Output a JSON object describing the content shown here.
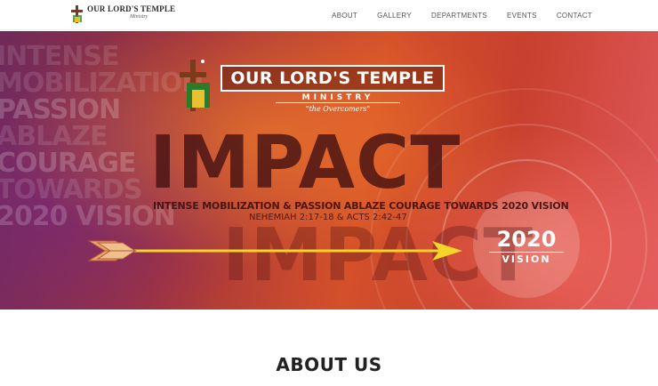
{
  "site": {
    "brand_title": "OUR LORD'S TEMPLE",
    "brand_sub": "Ministry"
  },
  "nav": {
    "items": [
      "ABOUT",
      "GALLERY",
      "DEPARTMENTS",
      "EVENTS",
      "CONTACT"
    ]
  },
  "hero": {
    "bg_words": [
      "INTENSE",
      "MOBILIZATION",
      "PASSION",
      "ABLAZE",
      "COURAGE",
      "TOWARDS",
      "2020 VISION"
    ],
    "logo_title": "OUR LORD'S TEMPLE",
    "logo_ministry": "MINISTRY",
    "logo_tagline": "\"the Overcomers\"",
    "headline": "IMPACT",
    "tagline": "INTENSE MOBILIZATION & PASSION ABLAZE COURAGE TOWARDS 2020 VISION",
    "verse": "NEHEMIAH 2:17-18 & ACTS 2:42-47",
    "vision_year": "2020",
    "vision_word": "VISION"
  },
  "about": {
    "heading": "ABOUT US"
  },
  "colors": {
    "hero_red": "#c8402e",
    "hero_orange": "#d4502a",
    "arrow_yellow": "#f2d42a",
    "cross_brown": "#7a3b1a",
    "nav_text": "#555555"
  }
}
